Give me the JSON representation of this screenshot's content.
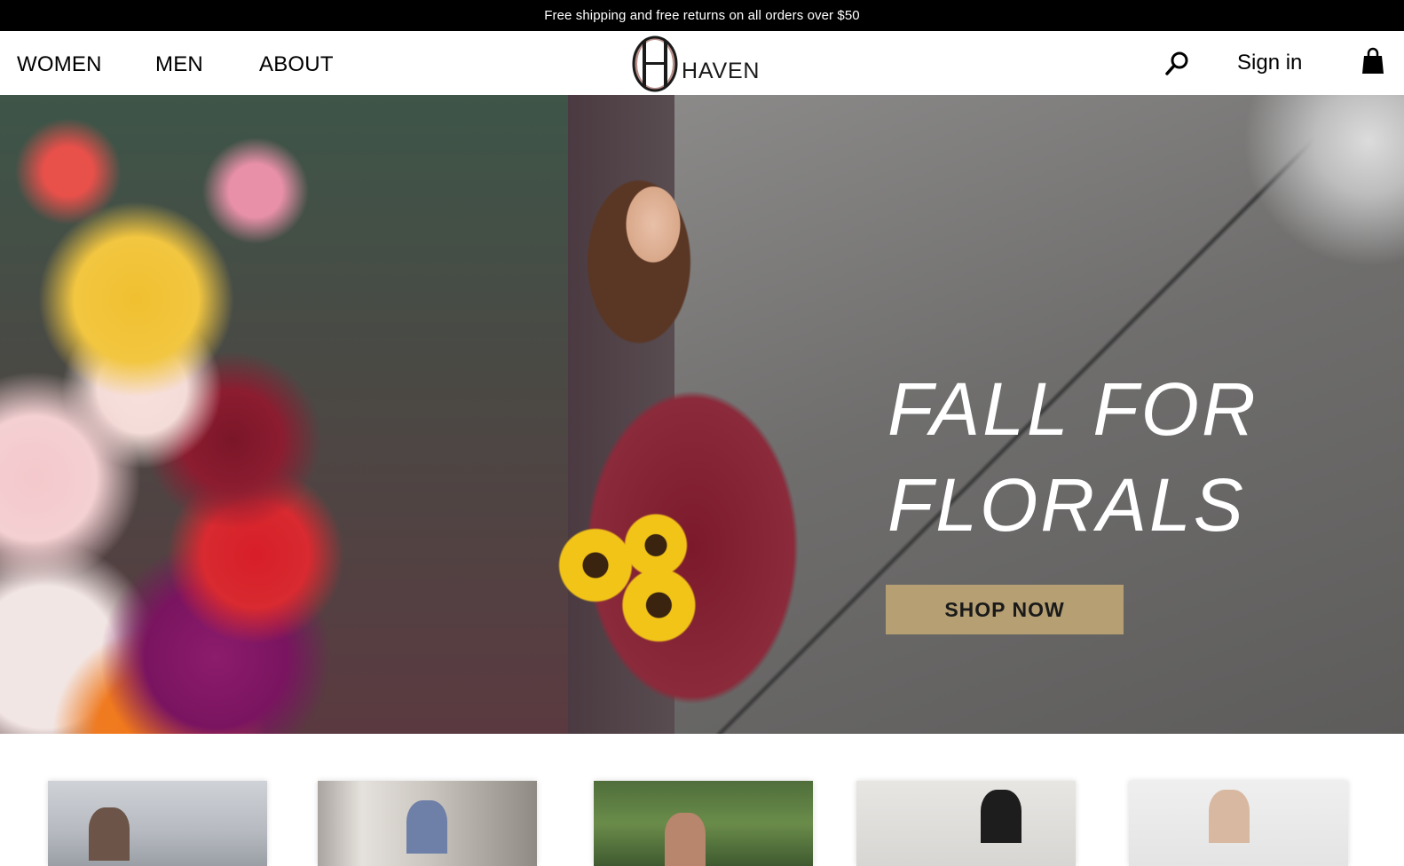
{
  "promo": {
    "text": "Free shipping and free returns on all orders over $50"
  },
  "nav": {
    "links": [
      {
        "label": "WOMEN"
      },
      {
        "label": "MEN"
      },
      {
        "label": "ABOUT"
      }
    ],
    "brand": "HAVEN",
    "signin_label": "Sign in",
    "icons": [
      "search-icon",
      "shopping-bag-icon"
    ]
  },
  "hero": {
    "title_line1": "FALL FOR",
    "title_line2": "FLORALS",
    "cta_label": "SHOP NOW",
    "cta_color": "#b59f73"
  },
  "categories": {
    "count_visible": 5
  },
  "colors": {
    "promo_bar": "#000000",
    "logo_accent": "#b8908a"
  }
}
